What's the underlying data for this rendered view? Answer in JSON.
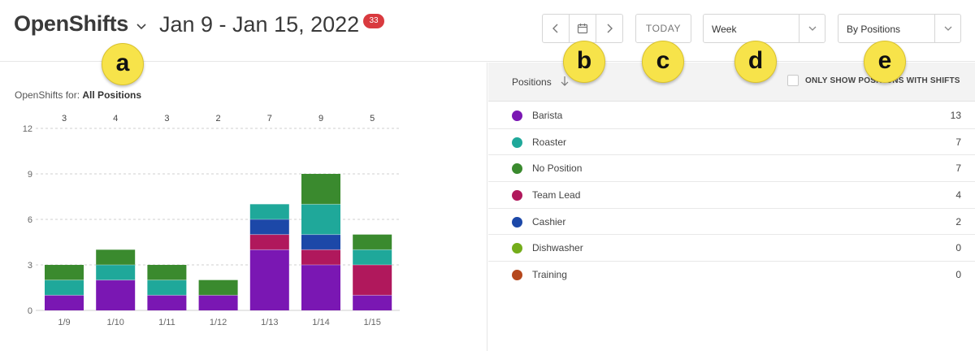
{
  "header": {
    "title": "OpenShifts",
    "date_range": "Jan 9 - Jan 15, 2022",
    "badge_count": "33",
    "today_label": "TODAY",
    "period_select": "Week",
    "view_select": "By Positions"
  },
  "callouts": [
    "a",
    "b",
    "c",
    "d",
    "e"
  ],
  "icons": {
    "title_dropdown": "chevron-down-icon",
    "prev": "chevron-left-icon",
    "calendar": "calendar-icon",
    "next": "chevron-right-icon",
    "select_arrow": "chevron-down-icon",
    "sort": "arrow-down-icon"
  },
  "left_panel": {
    "caption_prefix": "OpenShifts for:",
    "caption_value": "All Positions"
  },
  "colors": {
    "Barista": "#7a17b3",
    "Roaster": "#1fa89a",
    "No Position": "#3a8a2e",
    "Team Lead": "#b0185c",
    "Cashier": "#1c48a8",
    "Dishwasher": "#74ad1a",
    "Training": "#b5471c",
    "badge": "#d93a3f",
    "callout": "#f7e34a"
  },
  "chart_data": {
    "type": "bar",
    "stacked": true,
    "categories": [
      "1/9",
      "1/10",
      "1/11",
      "1/12",
      "1/13",
      "1/14",
      "1/15"
    ],
    "totals": [
      "3",
      "4",
      "3",
      "2",
      "7",
      "9",
      "5"
    ],
    "y_ticks": [
      "0",
      "3",
      "6",
      "9",
      "12"
    ],
    "ylim": [
      0,
      12
    ],
    "grid": true,
    "series": [
      {
        "name": "Barista",
        "values": [
          1,
          2,
          1,
          1,
          4,
          3,
          1
        ]
      },
      {
        "name": "Team Lead",
        "values": [
          0,
          0,
          0,
          0,
          1,
          1,
          2
        ]
      },
      {
        "name": "Cashier",
        "values": [
          0,
          0,
          0,
          0,
          1,
          1,
          0
        ]
      },
      {
        "name": "Roaster",
        "values": [
          1,
          1,
          1,
          0,
          1,
          2,
          1
        ]
      },
      {
        "name": "No Position",
        "values": [
          1,
          1,
          1,
          1,
          0,
          2,
          1
        ]
      }
    ]
  },
  "table": {
    "header_label": "Positions",
    "only_show_label": "ONLY SHOW POSITIONS WITH SHIFTS",
    "rows": [
      {
        "name": "Barista",
        "count": "13"
      },
      {
        "name": "Roaster",
        "count": "7"
      },
      {
        "name": "No Position",
        "count": "7"
      },
      {
        "name": "Team Lead",
        "count": "4"
      },
      {
        "name": "Cashier",
        "count": "2"
      },
      {
        "name": "Dishwasher",
        "count": "0"
      },
      {
        "name": "Training",
        "count": "0"
      }
    ]
  }
}
